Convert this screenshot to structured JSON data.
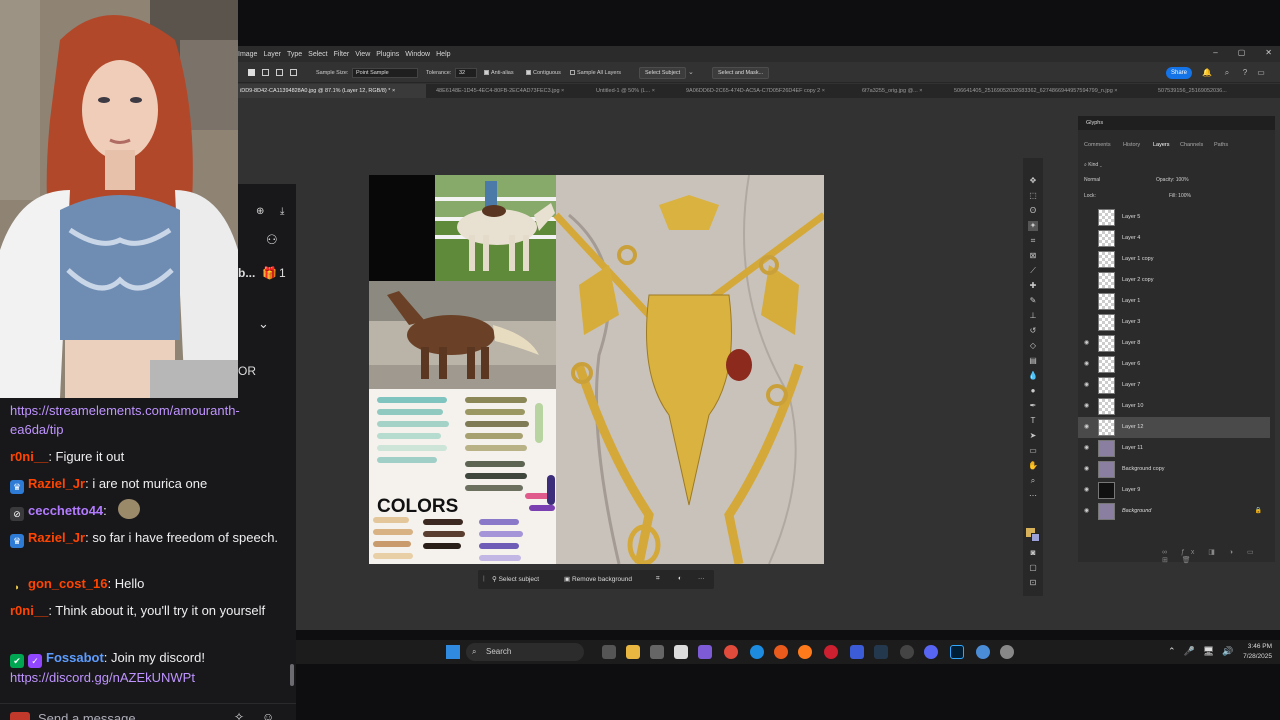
{
  "photoshop": {
    "menu": [
      "Image",
      "Layer",
      "Type",
      "Select",
      "Filter",
      "View",
      "Plugins",
      "Window",
      "Help"
    ],
    "options": {
      "sample_size_label": "Sample Size:",
      "sample_size_value": "Point Sample",
      "tolerance_label": "Tolerance:",
      "tolerance_value": "32",
      "anti_alias": "Anti-alias",
      "contiguous": "Contiguous",
      "sample_all_layers": "Sample All Layers",
      "select_subject": "Select Subject",
      "select_and_mask": "Select and Mask...",
      "share": "Share"
    },
    "tabs": [
      "iDD9-8D42-CA11394828A0.jpg @ 87.1% (Layer 12, RGB/8) *",
      "48E6148E-1D45-4EC4-80FB-2EC4AD73FEC3.jpg",
      "Untitled-1 @ 50% (L...",
      "9A06DD6D-2C65-474D-AC5A-C7D05F26D4EF copy 2",
      "6f7a3255_orig.jpg @...",
      "506641405_25169052032683362_6274866944957594799_n.jpg",
      "507539156_25169052036..."
    ],
    "canvas_text": "COLORS",
    "context_bar": {
      "select_subject": "Select subject",
      "remove_background": "Remove background",
      "more": "···"
    },
    "panels": {
      "glyphs": "Glyphs",
      "tabs": [
        "Comments",
        "History",
        "Layers",
        "Channels",
        "Paths"
      ],
      "filter_kind": "Kind",
      "blend_mode": "Normal",
      "opacity_label": "Opacity:",
      "opacity_value": "100%",
      "lock_label": "Lock:",
      "fill_label": "Fill:",
      "fill_value": "100%"
    },
    "layers": [
      {
        "name": "Layer 5",
        "visible": false
      },
      {
        "name": "Layer 4",
        "visible": false
      },
      {
        "name": "Layer 1 copy",
        "visible": false
      },
      {
        "name": "Layer 2 copy",
        "visible": false
      },
      {
        "name": "Layer 1",
        "visible": false
      },
      {
        "name": "Layer 3",
        "visible": false
      },
      {
        "name": "Layer 8",
        "visible": true
      },
      {
        "name": "Layer 6",
        "visible": true
      },
      {
        "name": "Layer 7",
        "visible": true
      },
      {
        "name": "Layer 10",
        "visible": true
      },
      {
        "name": "Layer 12",
        "visible": true,
        "selected": true
      },
      {
        "name": "Layer 11",
        "visible": true
      },
      {
        "name": "Background copy",
        "visible": true
      },
      {
        "name": "Layer 9",
        "visible": true
      },
      {
        "name": "Background",
        "visible": true,
        "locked": true
      }
    ]
  },
  "side_stub": {
    "partial_text": "b...",
    "count": "1",
    "partial_or": "OR"
  },
  "chat": {
    "messages": [
      {
        "user": "",
        "text": "https://streamelements.com/amouranth-ea6da/tip",
        "link": true
      },
      {
        "user": "r0ni__",
        "text": ": Figure it out",
        "color": "#ff4500"
      },
      {
        "user": "Raziel_Jr",
        "text": ": i are not murica one",
        "color": "#ff4500",
        "badge": "crown"
      },
      {
        "user": "cecchetto44",
        "text": ": ",
        "color": "#b37bff",
        "badge": "mute"
      },
      {
        "user": "Raziel_Jr",
        "text": ": so far i have freedom of speech.",
        "color": "#ff4500",
        "badge": "crown"
      },
      {
        "user": "gon_cost_16",
        "text": ": Hello",
        "color": "#ff4500",
        "badge": "banana"
      },
      {
        "user": "r0ni__",
        "text": ": Think about it, you'll try it on yourself",
        "color": "#ff4500"
      },
      {
        "user": "Fossabot",
        "text": ": Join my discord!",
        "color": "#5c9dff",
        "badge": "bot"
      },
      {
        "user": "",
        "text": "https://discord.gg/nAZEkUNWPt",
        "link": true
      }
    ],
    "input_placeholder": "Send a message"
  },
  "taskbar": {
    "search": "Search",
    "time": "3:46 PM",
    "date": "7/28/2025"
  },
  "colors": {
    "ps_bg": "#323232",
    "chat_bg": "#18181b",
    "accent": "#1473e6",
    "twitch_link": "#bf94ff"
  }
}
